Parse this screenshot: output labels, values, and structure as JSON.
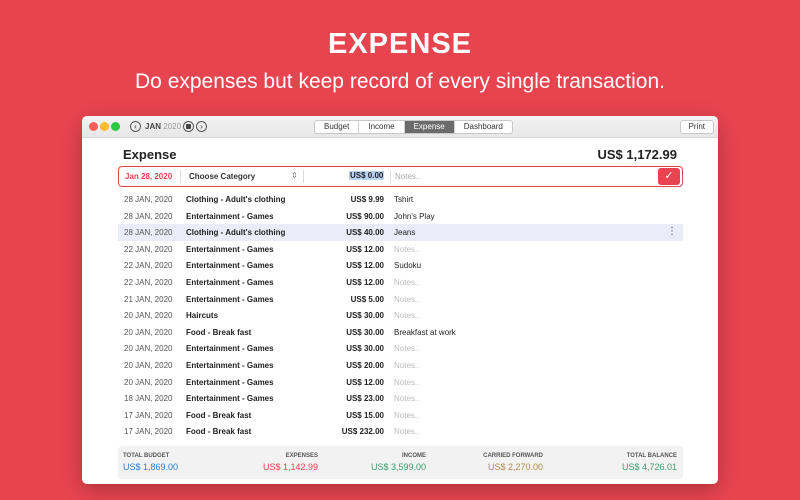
{
  "hero": {
    "title": "EXPENSE",
    "subtitle": "Do expenses but keep record of every single transaction."
  },
  "toolbar": {
    "month": "JAN",
    "year": "2020",
    "tabs": [
      "Budget",
      "Income",
      "Expense",
      "Dashboard"
    ],
    "active_tab": "Expense",
    "print_label": "Print"
  },
  "page": {
    "title": "Expense",
    "total": "US$ 1,172.99"
  },
  "entry": {
    "date": "Jan 28, 2020",
    "category_placeholder": "Choose Category",
    "amount": "US$  0.00",
    "notes_placeholder": "Notes..",
    "confirm_icon": "checkmark-icon"
  },
  "transactions": [
    {
      "date": "28 JAN, 2020",
      "category": "Clothing - Adult's clothing",
      "amount": "US$ 9.99",
      "note": "Tshirt"
    },
    {
      "date": "28 JAN, 2020",
      "category": "Entertainment - Games",
      "amount": "US$ 90.00",
      "note": "John's Play"
    },
    {
      "date": "28 JAN, 2020",
      "category": "Clothing - Adult's clothing",
      "amount": "US$ 40.00",
      "note": "Jeans"
    },
    {
      "date": "22 JAN, 2020",
      "category": "Entertainment - Games",
      "amount": "US$ 12.00",
      "note": "Notes.."
    },
    {
      "date": "22 JAN, 2020",
      "category": "Entertainment - Games",
      "amount": "US$ 12.00",
      "note": "Sudoku"
    },
    {
      "date": "22 JAN, 2020",
      "category": "Entertainment - Games",
      "amount": "US$ 12.00",
      "note": "Notes.."
    },
    {
      "date": "21 JAN, 2020",
      "category": "Entertainment - Games",
      "amount": "US$ 5.00",
      "note": "Notes.."
    },
    {
      "date": "20 JAN, 2020",
      "category": "Haircuts",
      "amount": "US$ 30.00",
      "note": "Notes.."
    },
    {
      "date": "20 JAN, 2020",
      "category": "Food - Break fast",
      "amount": "US$ 30.00",
      "note": "Breakfast at work"
    },
    {
      "date": "20 JAN, 2020",
      "category": "Entertainment - Games",
      "amount": "US$ 30.00",
      "note": "Notes.."
    },
    {
      "date": "20 JAN, 2020",
      "category": "Entertainment - Games",
      "amount": "US$ 20.00",
      "note": "Notes.."
    },
    {
      "date": "20 JAN, 2020",
      "category": "Entertainment - Games",
      "amount": "US$ 12.00",
      "note": "Notes.."
    },
    {
      "date": "18 JAN, 2020",
      "category": "Entertainment - Games",
      "amount": "US$ 23.00",
      "note": "Notes.."
    },
    {
      "date": "17 JAN, 2020",
      "category": "Food - Break fast",
      "amount": "US$ 15.00",
      "note": "Notes.."
    },
    {
      "date": "17 JAN, 2020",
      "category": "Food - Break fast",
      "amount": "US$ 232.00",
      "note": "Notes.."
    }
  ],
  "selected_row": 2,
  "summary": {
    "total_budget": {
      "label": "TOTAL BUDGET",
      "value": "US$ 1,869.00",
      "color": "#2b7bd6"
    },
    "expenses": {
      "label": "EXPENSES",
      "value": "US$ 1,142.99",
      "color": "#e8444f"
    },
    "income": {
      "label": "INCOME",
      "value": "US$ 3,599.00",
      "color": "#3f9a6b"
    },
    "carried_forward": {
      "label": "CARRIED FORWARD",
      "value": "US$ 2,270.00",
      "color": "#b08a4a"
    },
    "total_balance": {
      "label": "TOTAL BALANCE",
      "value": "US$ 4,726.01",
      "color": "#3f9a6b"
    }
  },
  "colors": {
    "accent": "#e8444f",
    "selected_row": "#eaecf9"
  }
}
